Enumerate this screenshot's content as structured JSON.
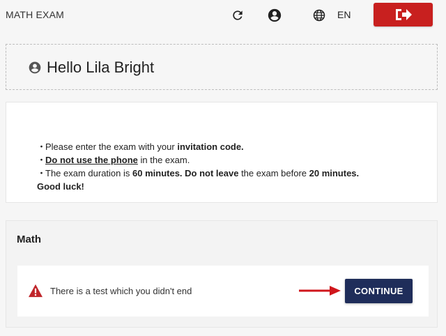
{
  "header": {
    "title": "MATH EXAM",
    "language": "EN",
    "icons": {
      "refresh": "refresh-icon",
      "account": "account-circle-icon",
      "language": "globe-icon",
      "logout": "logout-icon"
    },
    "logout_color": "#c8201f"
  },
  "greeting": {
    "text": "Hello Lila Bright"
  },
  "instructions": {
    "line1_pre": "Please enter the exam with your ",
    "line1_bold": "invitation code.",
    "line2_underline": "Do not use the phone",
    "line2_post": " in the exam.",
    "line3_pre": "The exam duration is ",
    "line3_bold1": "60 minutes. Do not leave",
    "line3_mid": " the exam before ",
    "line3_bold2": "20 minutes.",
    "line4": "Good luck!"
  },
  "exam": {
    "name": "Math",
    "notice": "There is a test which you didn't end",
    "continue_label": "CONTINUE",
    "continue_color": "#1f2d5a"
  }
}
